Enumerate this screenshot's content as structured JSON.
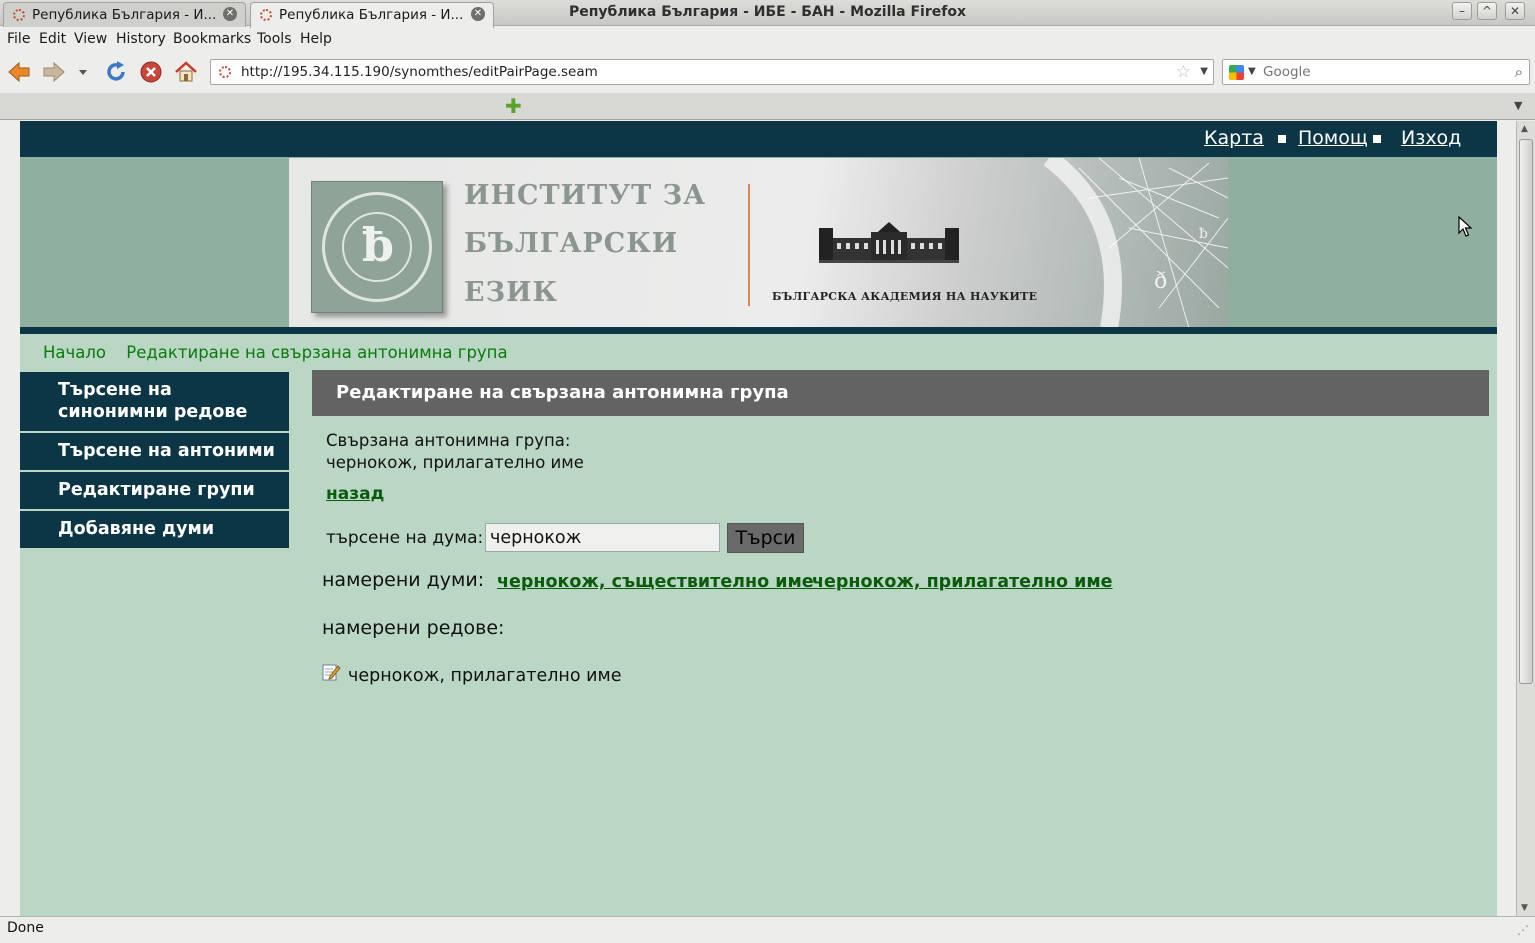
{
  "window": {
    "title": "Република България - ИБЕ - БАН - Mozilla Firefox",
    "minimize_icon": "minimize-icon",
    "maximize_icon": "maximize-icon",
    "close_icon": "close-icon"
  },
  "menu": [
    "File",
    "Edit",
    "View",
    "History",
    "Bookmarks",
    "Tools",
    "Help"
  ],
  "toolbar": {
    "url": "http://195.34.115.190/synomthes/editPairPage.seam",
    "search_placeholder": "Google"
  },
  "tabs": [
    {
      "label": "Република България - И...",
      "active": false
    },
    {
      "label": "Република България - И...",
      "active": true
    }
  ],
  "page": {
    "top_links": [
      "Карта",
      "Помощ",
      "Изход"
    ],
    "banner": {
      "institute_lines": [
        "ИНСТИТУТ ЗА",
        "БЪЛГАРСКИ",
        "ЕЗИК"
      ],
      "academy": "БЪЛГАРСКА АКАДЕМИЯ НА НАУКИТЕ"
    },
    "breadcrumb": [
      "Начало",
      "Редактиране на свързана антонимна група"
    ],
    "sidebar": [
      "Търсене на синонимни редове",
      "Търсене на антоними",
      "Редактиране групи",
      "Добавяне думи"
    ],
    "content": {
      "heading": "Редактиране на свързана антонимна група",
      "group_label": "Свързана антонимна група:",
      "group_value": "чернокож, прилагателно име",
      "back_link": "назад",
      "search_label": "търсене на дума:",
      "search_value": "чернокож",
      "search_button": "Търси",
      "found_words_label": "намерени думи:",
      "found_words": [
        "чернокож, съществително име",
        "чернокож, прилагателно име"
      ],
      "found_rows_label": "намерени редове:",
      "found_rows": [
        "чернокож, прилагателно име"
      ]
    }
  },
  "status": "Done",
  "colors": {
    "page_bg": "#bad7c6",
    "dark_nav": "#0c3646",
    "heading_bar": "#636363",
    "link_green": "#0a5c0a"
  }
}
